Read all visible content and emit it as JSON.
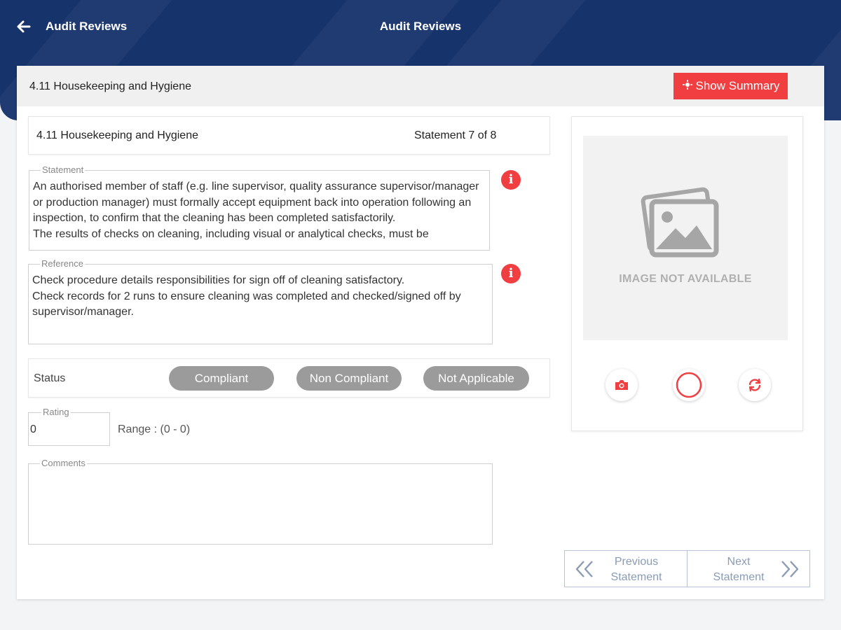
{
  "header": {
    "back_title": "Audit Reviews",
    "center_title": "Audit Reviews"
  },
  "section": {
    "title": "4.11 Housekeeping and Hygiene",
    "summary_button": "Show Summary"
  },
  "statement_header": {
    "title": "4.11 Housekeeping and Hygiene",
    "counter": "Statement 7 of 8"
  },
  "statement": {
    "label": "Statement",
    "text": "An authorised member of staff (e.g. line supervisor, quality assurance supervisor/manager or production manager) must formally accept equipment back into operation following an inspection, to confirm that the cleaning has been completed satisfactorily.\nThe results of checks on cleaning, including visual or analytical checks, must be"
  },
  "reference": {
    "label": "Reference",
    "text": "Check procedure details responsibilities for sign off of cleaning satisfactory.\nCheck records for 2 runs to ensure cleaning was completed and checked/signed off by supervisor/manager."
  },
  "status": {
    "label": "Status",
    "options": [
      "Compliant",
      "Non Compliant",
      "Not Applicable"
    ]
  },
  "rating": {
    "label": "Rating",
    "value": "0",
    "range": "Range : (0 - 0)"
  },
  "comments": {
    "label": "Comments",
    "value": ""
  },
  "image_panel": {
    "placeholder_text": "IMAGE NOT AVAILABLE",
    "icons": [
      "camera-icon",
      "circle-icon",
      "refresh-icon"
    ]
  },
  "navigation": {
    "previous": "Previous\nStatement",
    "next": "Next\nStatement"
  },
  "colors": {
    "header": "#16336b",
    "accent": "#f03e41",
    "pill": "#9b9b9b",
    "nav_text": "#8a9bb5"
  }
}
